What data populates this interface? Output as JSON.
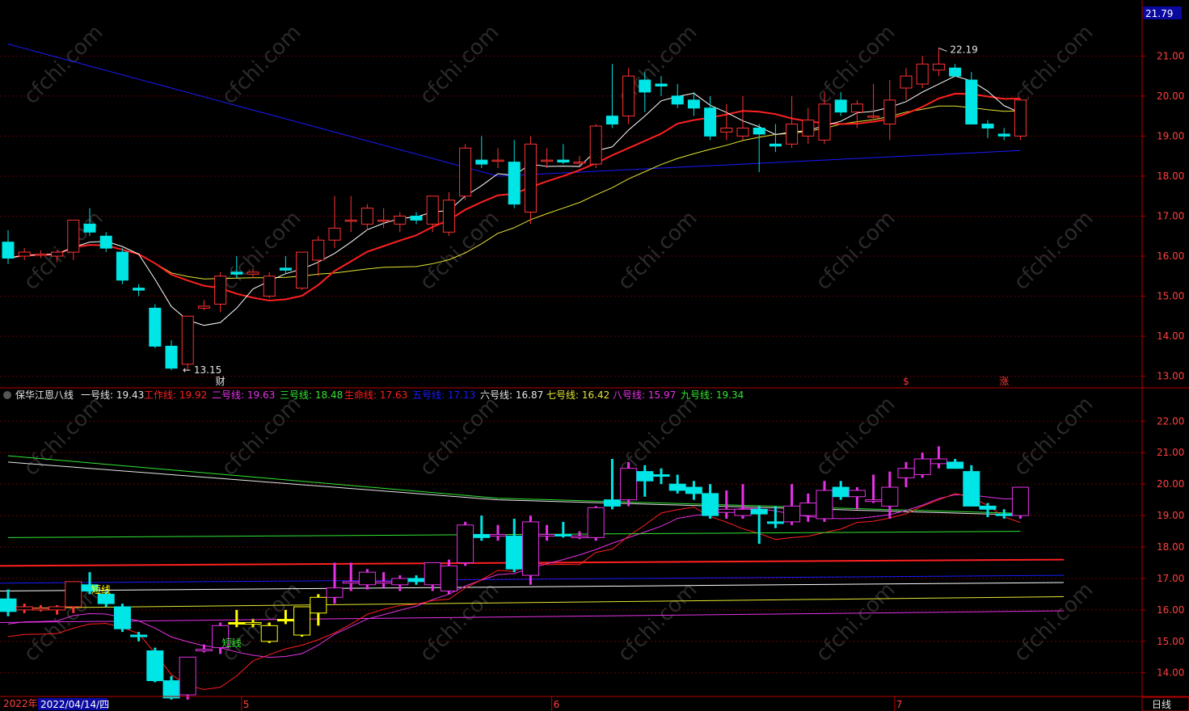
{
  "colors": {
    "background": "#000000",
    "up": "#ff3232",
    "down": "#00e5e5",
    "grid": "#6a0000",
    "axis": "#b40000",
    "ma5": "#ffffff",
    "ma10": "#ff2020",
    "ma20": "#e6e632",
    "ma60": "#1a1aff",
    "price_tag_bg": "#0a0aa0",
    "upper_magenta": "#e632e6",
    "yellow_bar": "#ffff00"
  },
  "main_panel": {
    "price_tag": "21.79",
    "y_ticks": [
      "21.00",
      "20.00",
      "19.00",
      "18.00",
      "17.00",
      "16.00",
      "15.00",
      "14.00",
      "13.00"
    ],
    "ylim": [
      12.75,
      22.4
    ],
    "max_label": "22.19",
    "min_label": "13.15",
    "markers": [
      {
        "index": 13,
        "text": "财",
        "color": "#e6e6e6"
      },
      {
        "index": 55,
        "text": "$",
        "color": "#ff3232"
      },
      {
        "index": 61,
        "text": "涨",
        "color": "#ff3232"
      }
    ]
  },
  "indicator_panel": {
    "name": "保华江恩八线",
    "y_ticks": [
      "22.00",
      "21.00",
      "20.00",
      "19.00",
      "18.00",
      "17.00",
      "16.00",
      "15.00",
      "14.00"
    ],
    "ylim": [
      13.3,
      22.65
    ],
    "labels": [
      {
        "text": "一号线: 19.43",
        "color": "#e6e6e6"
      },
      {
        "text": "工作线: 19.92",
        "color": "#ff2020"
      },
      {
        "text": "二号线: 19.63",
        "color": "#e632e6"
      },
      {
        "text": "三号线: 18.48",
        "color": "#32e632"
      },
      {
        "text": "生命线: 17.63",
        "color": "#ff2020"
      },
      {
        "text": "五号线: 17.13",
        "color": "#1a1aff"
      },
      {
        "text": "六号线: 16.87",
        "color": "#e6e6e6"
      },
      {
        "text": "七号线: 16.42",
        "color": "#e6e632"
      },
      {
        "text": "八号线: 15.97",
        "color": "#e632e6"
      },
      {
        "text": "九号线: 19.34",
        "color": "#32e632"
      }
    ],
    "annotations": [
      {
        "index": 5,
        "text": "短线",
        "color": "#ffff00"
      },
      {
        "index": 13,
        "text": "短线",
        "color": "#32e632"
      }
    ],
    "levels": [
      {
        "name": "生命线",
        "from": 17.4,
        "to": 17.6,
        "color": "#ff2020",
        "width": 2
      },
      {
        "name": "五号线",
        "from": 16.85,
        "to": 17.1,
        "color": "#1a1aff",
        "width": 1
      },
      {
        "name": "六号线",
        "from": 16.6,
        "to": 16.87,
        "color": "#ffffff",
        "width": 1
      },
      {
        "name": "七号线",
        "from": 16.05,
        "to": 16.42,
        "color": "#e6e632",
        "width": 1
      },
      {
        "name": "八号线",
        "from": 15.6,
        "to": 15.97,
        "color": "#e632e6",
        "width": 1
      }
    ]
  },
  "footer": {
    "period_label": "日线",
    "date_prefix": "2022年",
    "date_box": "2022/04/14/四",
    "month_marks": [
      {
        "index": 14,
        "text": "5"
      },
      {
        "index": 33,
        "text": "6"
      },
      {
        "index": 54,
        "text": "7"
      }
    ]
  },
  "watermark": "cfchi.com",
  "chart_data": {
    "type": "candlestick",
    "ohlc": [
      [
        16.35,
        16.65,
        15.8,
        15.95
      ],
      [
        16.0,
        16.2,
        15.9,
        16.1
      ],
      [
        16.05,
        16.15,
        15.95,
        16.05
      ],
      [
        16.0,
        16.15,
        15.85,
        16.1
      ],
      [
        16.1,
        16.9,
        15.9,
        16.9
      ],
      [
        16.8,
        17.2,
        16.5,
        16.6
      ],
      [
        16.5,
        16.6,
        16.1,
        16.2
      ],
      [
        16.1,
        16.2,
        15.3,
        15.4
      ],
      [
        15.2,
        15.3,
        15.0,
        15.15
      ],
      [
        14.7,
        14.8,
        13.7,
        13.75
      ],
      [
        13.75,
        13.9,
        13.15,
        13.2
      ],
      [
        13.3,
        14.5,
        13.15,
        14.5
      ],
      [
        14.7,
        14.9,
        14.65,
        14.75
      ],
      [
        14.8,
        15.6,
        14.6,
        15.5
      ],
      [
        15.6,
        16.0,
        15.45,
        15.55
      ],
      [
        15.55,
        15.7,
        15.45,
        15.6
      ],
      [
        15.0,
        15.6,
        14.95,
        15.5
      ],
      [
        15.7,
        16.0,
        15.55,
        15.65
      ],
      [
        15.2,
        16.1,
        15.15,
        16.1
      ],
      [
        15.9,
        16.5,
        15.5,
        16.4
      ],
      [
        16.4,
        17.5,
        16.2,
        16.7
      ],
      [
        16.9,
        17.5,
        16.6,
        16.9
      ],
      [
        16.8,
        17.3,
        16.65,
        17.2
      ],
      [
        16.9,
        17.2,
        16.7,
        16.9
      ],
      [
        16.8,
        17.1,
        16.6,
        17.0
      ],
      [
        17.0,
        17.1,
        16.8,
        16.9
      ],
      [
        16.8,
        17.5,
        16.6,
        17.5
      ],
      [
        16.6,
        17.6,
        16.5,
        17.4
      ],
      [
        17.5,
        18.8,
        17.4,
        18.7
      ],
      [
        18.4,
        19.0,
        18.2,
        18.3
      ],
      [
        18.4,
        18.7,
        18.2,
        18.4
      ],
      [
        18.35,
        18.9,
        17.2,
        17.3
      ],
      [
        17.1,
        19.0,
        16.8,
        18.8
      ],
      [
        18.4,
        18.7,
        18.2,
        18.4
      ],
      [
        18.4,
        18.8,
        18.3,
        18.35
      ],
      [
        18.35,
        18.5,
        18.25,
        18.35
      ],
      [
        18.3,
        19.3,
        18.2,
        19.25
      ],
      [
        19.5,
        20.8,
        19.2,
        19.3
      ],
      [
        19.5,
        20.7,
        19.3,
        20.5
      ],
      [
        20.4,
        20.6,
        19.6,
        20.1
      ],
      [
        20.3,
        20.5,
        20.0,
        20.25
      ],
      [
        20.0,
        20.3,
        19.7,
        19.8
      ],
      [
        19.9,
        20.1,
        19.5,
        19.7
      ],
      [
        19.7,
        20.0,
        18.9,
        19.0
      ],
      [
        19.1,
        19.8,
        18.9,
        19.2
      ],
      [
        19.0,
        20.0,
        18.9,
        19.2
      ],
      [
        19.2,
        19.3,
        18.1,
        19.05
      ],
      [
        18.8,
        19.3,
        18.6,
        18.75
      ],
      [
        18.8,
        20.0,
        18.7,
        19.3
      ],
      [
        19.0,
        19.7,
        18.8,
        19.4
      ],
      [
        18.9,
        20.1,
        18.8,
        19.8
      ],
      [
        19.9,
        20.1,
        19.5,
        19.6
      ],
      [
        19.6,
        19.9,
        19.2,
        19.8
      ],
      [
        19.5,
        20.3,
        19.4,
        19.5
      ],
      [
        19.3,
        20.4,
        18.9,
        19.9
      ],
      [
        20.2,
        20.7,
        19.9,
        20.5
      ],
      [
        20.3,
        21.0,
        20.2,
        20.8
      ],
      [
        20.65,
        21.2,
        20.5,
        20.8
      ],
      [
        20.7,
        20.8,
        20.5,
        20.5
      ],
      [
        20.4,
        20.6,
        19.4,
        19.3
      ],
      [
        19.3,
        19.4,
        18.95,
        19.2
      ],
      [
        19.05,
        19.2,
        18.9,
        19.0
      ],
      [
        19.0,
        19.9,
        18.9,
        19.9
      ]
    ],
    "ma5": [],
    "ma10": [],
    "ma20": [],
    "ma60": []
  }
}
